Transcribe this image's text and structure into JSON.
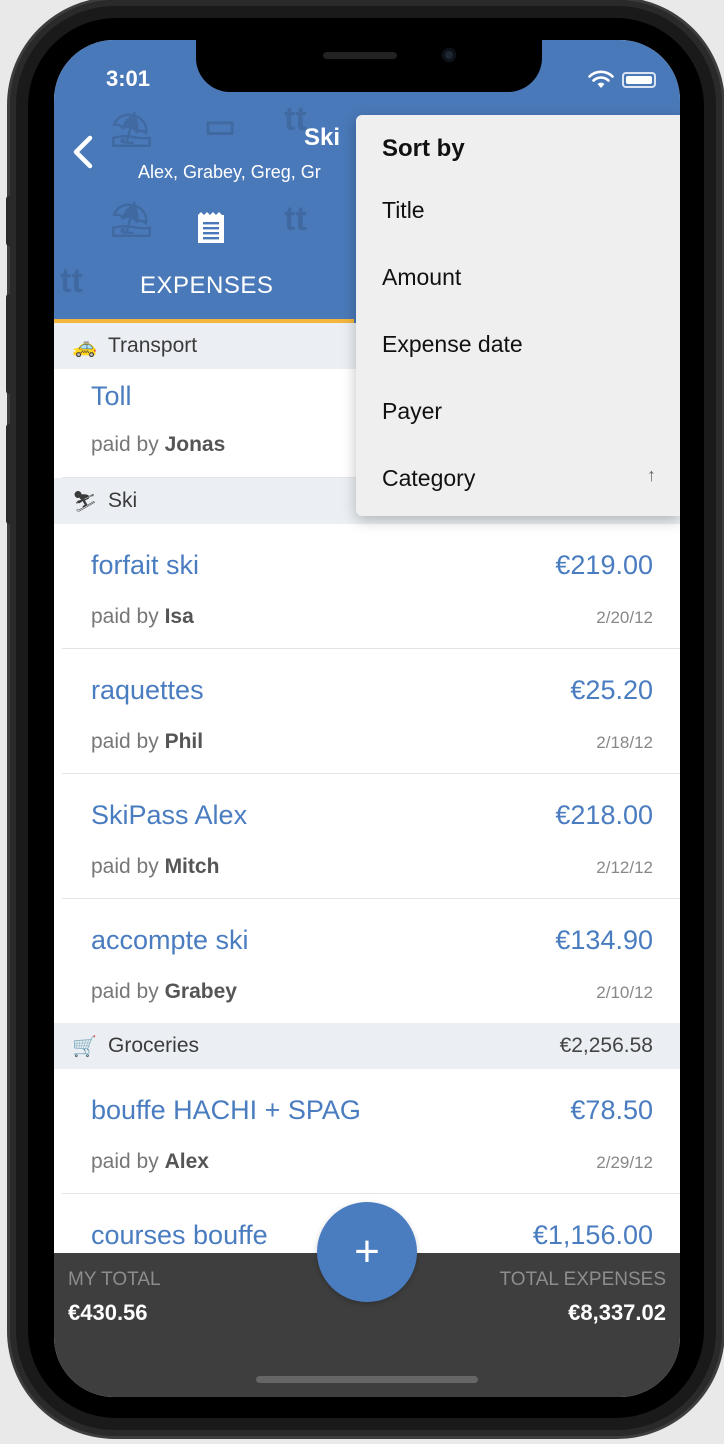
{
  "status": {
    "time": "3:01"
  },
  "header": {
    "title": "Ski",
    "subtitle": "Alex, Grabey, Greg, Gr",
    "tab_label": "EXPENSES"
  },
  "sort_menu": {
    "heading": "Sort by",
    "items": [
      {
        "label": "Title"
      },
      {
        "label": "Amount"
      },
      {
        "label": "Expense date"
      },
      {
        "label": "Payer"
      },
      {
        "label": "Category",
        "indicator": "↑"
      }
    ]
  },
  "sections": [
    {
      "emoji": "🚕",
      "name": "Transport",
      "total": "",
      "expenses": [
        {
          "title": "Toll",
          "amount": "",
          "paid_by_prefix": "paid by",
          "payer": "Jonas",
          "date": ""
        }
      ]
    },
    {
      "emoji": "⛷",
      "name": "Ski",
      "total": "",
      "expenses": [
        {
          "title": "forfait ski",
          "amount": "€219.00",
          "paid_by_prefix": "paid by",
          "payer": "Isa",
          "date": "2/20/12"
        },
        {
          "title": "raquettes",
          "amount": "€25.20",
          "paid_by_prefix": "paid by",
          "payer": "Phil",
          "date": "2/18/12"
        },
        {
          "title": "SkiPass Alex",
          "amount": "€218.00",
          "paid_by_prefix": "paid by",
          "payer": "Mitch",
          "date": "2/12/12"
        },
        {
          "title": "accompte ski",
          "amount": "€134.90",
          "paid_by_prefix": "paid by",
          "payer": "Grabey",
          "date": "2/10/12"
        }
      ]
    },
    {
      "emoji": "🛒",
      "name": "Groceries",
      "total": "€2,256.58",
      "expenses": [
        {
          "title": "bouffe HACHI + SPAG",
          "amount": "€78.50",
          "paid_by_prefix": "paid by",
          "payer": "Alex",
          "date": "2/29/12"
        },
        {
          "title": "courses bouffe",
          "amount": "€1,156.00",
          "paid_by_prefix": "",
          "payer": "",
          "date": ""
        }
      ]
    }
  ],
  "footer": {
    "my_total_label": "MY TOTAL",
    "my_total_value": "€430.56",
    "total_expenses_label": "TOTAL EXPENSES",
    "total_expenses_value": "€8,337.02"
  },
  "fab_icon": "+",
  "colors": {
    "header": "#4a79b9",
    "accent": "#4a7cc0",
    "tab_indicator": "#f3b53c",
    "footer": "#3e3e3e"
  }
}
